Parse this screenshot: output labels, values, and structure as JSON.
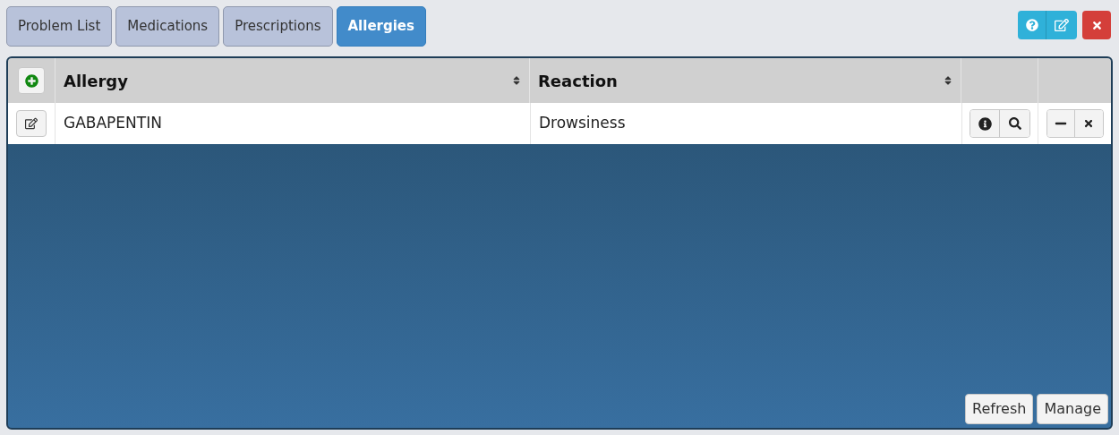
{
  "tabs": [
    {
      "label": "Problem List",
      "selected": false
    },
    {
      "label": "Medications",
      "selected": false
    },
    {
      "label": "Prescriptions",
      "selected": false
    },
    {
      "label": "Allergies",
      "selected": true
    }
  ],
  "table": {
    "columns": [
      "Allergy",
      "Reaction"
    ],
    "rows": [
      {
        "allergy": "GABAPENTIN",
        "reaction": "Drowsiness"
      }
    ]
  },
  "footer_buttons": [
    "Refresh",
    "Manage"
  ]
}
